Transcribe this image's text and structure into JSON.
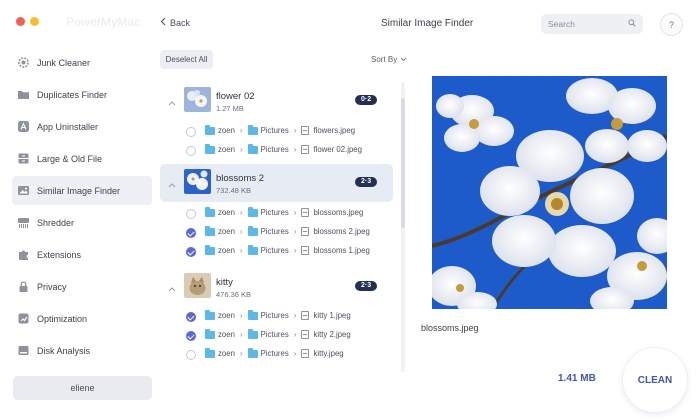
{
  "app": {
    "brand": "PowerMyMac",
    "title": "Similar Image Finder"
  },
  "toolbar": {
    "back_label": "Back",
    "search_placeholder": "Search",
    "help_label": "?"
  },
  "sidebar": {
    "items": [
      {
        "label": "Junk Cleaner",
        "icon": "gear-icon",
        "active": false
      },
      {
        "label": "Duplicates Finder",
        "icon": "folder-icon",
        "active": false
      },
      {
        "label": "App Uninstaller",
        "icon": "app-store-icon",
        "active": false
      },
      {
        "label": "Large & Old File",
        "icon": "cabinet-icon",
        "active": false
      },
      {
        "label": "Similar Image Finder",
        "icon": "image-icon",
        "active": true
      },
      {
        "label": "Shredder",
        "icon": "shredder-icon",
        "active": false
      },
      {
        "label": "Extensions",
        "icon": "extensions-icon",
        "active": false
      },
      {
        "label": "Privacy",
        "icon": "lock-icon",
        "active": false
      },
      {
        "label": "Optimization",
        "icon": "optimization-icon",
        "active": false
      },
      {
        "label": "Disk Analysis",
        "icon": "disk-icon",
        "active": false
      }
    ],
    "user": "eliene"
  },
  "list": {
    "deselect_label": "Deselect All",
    "sort_label": "Sort By",
    "groups": [
      {
        "name": "flower 02",
        "size": "1.27 MB",
        "badge": "0·2",
        "selected": false,
        "files": [
          {
            "checked": false,
            "user": "zoen",
            "folder": "Pictures",
            "file": "flowers.jpeg"
          },
          {
            "checked": false,
            "user": "zoen",
            "folder": "Pictures",
            "file": "flower 02.jpeg"
          }
        ]
      },
      {
        "name": "blossoms 2",
        "size": "732.48 KB",
        "badge": "2·3",
        "selected": true,
        "files": [
          {
            "checked": false,
            "user": "zoen",
            "folder": "Pictures",
            "file": "blossoms.jpeg"
          },
          {
            "checked": true,
            "user": "zoen",
            "folder": "Pictures",
            "file": "blossoms 2.jpeg"
          },
          {
            "checked": true,
            "user": "zoen",
            "folder": "Pictures",
            "file": "blossoms 1.jpeg"
          }
        ]
      },
      {
        "name": "kitty",
        "size": "476.36 KB",
        "badge": "2·3",
        "selected": false,
        "files": [
          {
            "checked": true,
            "user": "zoen",
            "folder": "Pictures",
            "file": "kitty 1.jpeg"
          },
          {
            "checked": true,
            "user": "zoen",
            "folder": "Pictures",
            "file": "kitty 2.jpeg"
          },
          {
            "checked": false,
            "user": "zoen",
            "folder": "Pictures",
            "file": "kitty.jpeg"
          }
        ]
      }
    ]
  },
  "preview": {
    "filename": "blossoms.jpeg",
    "total_size": "1.41 MB",
    "clean_label": "CLEAN"
  },
  "colors": {
    "accent": "#3e57b4",
    "badge_bg": "#243052",
    "check_on": "#5c67d8",
    "sky": "#1f5fcf",
    "folder": "#5bb8e8"
  }
}
